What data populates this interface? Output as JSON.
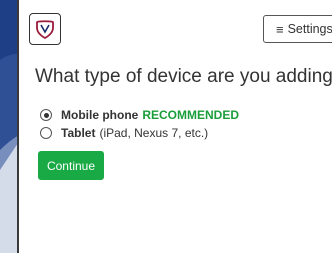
{
  "header": {
    "logo_icon": "duo-shield-logo-icon",
    "settings_label": "Settings",
    "settings_icon": "hamburger-menu-icon"
  },
  "main": {
    "question": "What type of device are you adding?",
    "options": [
      {
        "label": "Mobile phone",
        "badge": "RECOMMENDED",
        "note": "",
        "selected": true
      },
      {
        "label": "Tablet",
        "badge": "",
        "note": "(iPad, Nexus 7, etc.)",
        "selected": false
      }
    ],
    "continue_label": "Continue"
  },
  "colors": {
    "background": "#1e3f86",
    "accent_green": "#1aaa45",
    "recommended_green": "#1a9e3a"
  }
}
